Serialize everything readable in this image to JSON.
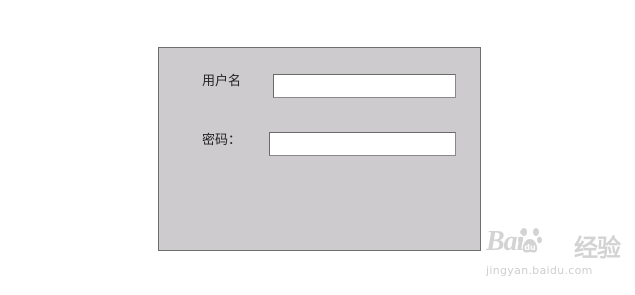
{
  "login_form": {
    "username_label": "用户名",
    "password_label": "密码：",
    "username_value": "",
    "password_value": ""
  },
  "watermark": {
    "brand_left": "Bai",
    "brand_right": "经验",
    "url": "jingyan.baidu.com",
    "icon": "baidu-paw-icon"
  },
  "colors": {
    "panel_bg": "#cdcbcd",
    "panel_border": "#6e6e6e",
    "page_bg": "#ffffff"
  }
}
